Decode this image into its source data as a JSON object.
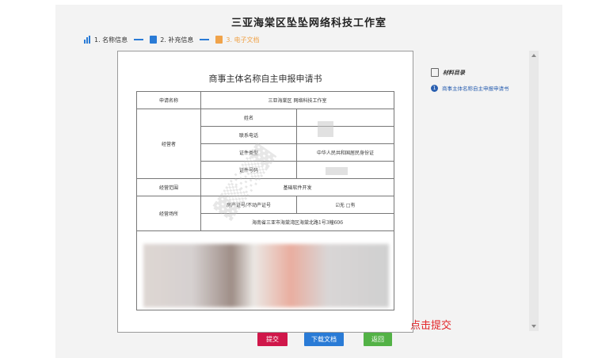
{
  "header": {
    "title": "三亚海棠区坠坠网络科技工作室"
  },
  "steps": [
    {
      "label": "1. 名称信息"
    },
    {
      "label": "2. 补充信息"
    },
    {
      "label": "3. 电子文档"
    }
  ],
  "document": {
    "title": "商事主体名称自主申报申请书",
    "rows": {
      "applicant_name_label": "申请名称",
      "applicant_name_value": "三亚海棠区 网络科技工作室",
      "operator_label": "经营者",
      "name_label": "姓名",
      "phone_label": "联系电话",
      "id_type_label": "证件类型",
      "id_type_value": "中华人民共和国居民身份证",
      "id_number_label": "证件号码",
      "scope_label": "经营范围",
      "scope_value": "基础软件开发",
      "place_label": "经营场所",
      "property_label": "房产证号/不动产证号",
      "property_none": "☑无",
      "property_have": "□有",
      "address_value": "海南省三亚市海棠湾区海棠北路1号3幢606"
    }
  },
  "sidebar": {
    "header": "材料目录",
    "items": [
      {
        "num": "1",
        "label": "商事主体名称自主申报申请书"
      }
    ]
  },
  "buttons": {
    "submit": "提交",
    "download": "下载文档",
    "back": "返回"
  },
  "hint": "点击提交",
  "colors": {
    "accent": "#2a7bd6",
    "submit": "#d0174a",
    "back": "#53b246",
    "step_active": "#f0a34a",
    "hint": "#e3262a"
  }
}
